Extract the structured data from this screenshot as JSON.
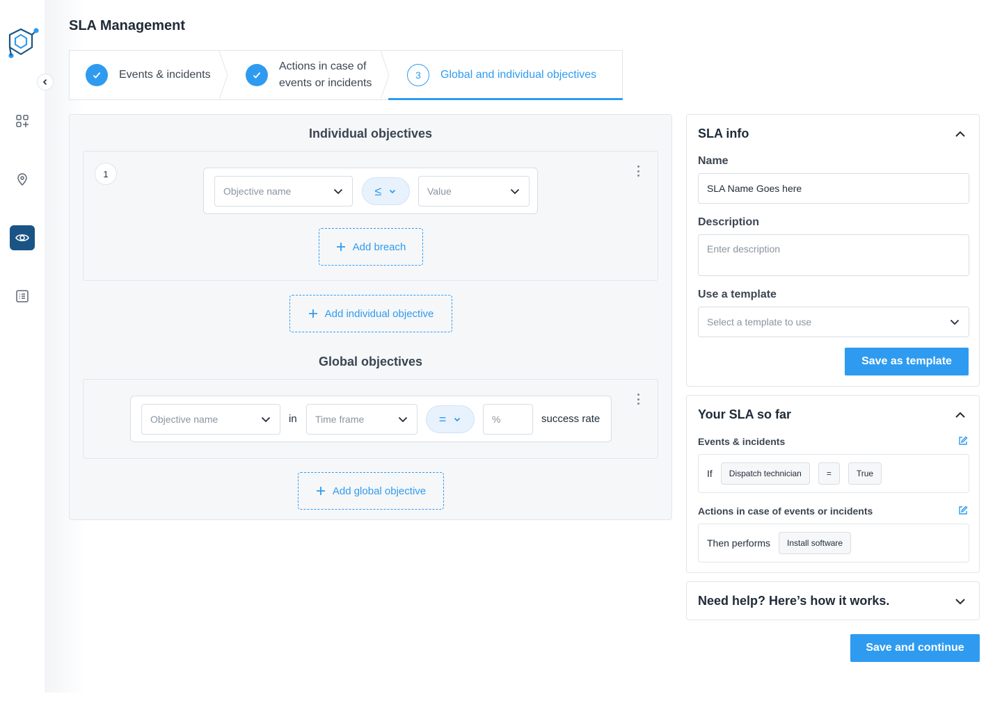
{
  "app": {
    "title": "SLA Management"
  },
  "nav": {
    "items": [
      {
        "name": "dashboard-icon",
        "active": false
      },
      {
        "name": "location-icon",
        "active": false
      },
      {
        "name": "eye-icon",
        "active": true
      },
      {
        "name": "list-icon",
        "active": false
      }
    ]
  },
  "stepper": {
    "steps": [
      {
        "label": "Events & incidents",
        "status": "completed"
      },
      {
        "label": "Actions in case of events or incidents",
        "status": "completed"
      },
      {
        "number": "3",
        "label": "Global and individual objectives",
        "status": "current"
      }
    ]
  },
  "individual": {
    "title": "Individual objectives",
    "objectives": [
      {
        "number": "1",
        "name_placeholder": "Objective name",
        "operator": "≤",
        "value_placeholder": "Value"
      }
    ],
    "add_breach_label": "Add breach",
    "add_objective_label": "Add individual objective"
  },
  "global": {
    "title": "Global objectives",
    "objective": {
      "name_placeholder": "Objective name",
      "in_label": "in",
      "timeframe_placeholder": "Time frame",
      "operator": "=",
      "percent_placeholder": "%",
      "suffix": "success rate"
    },
    "add_objective_label": "Add global objective"
  },
  "sla_info": {
    "title": "SLA info",
    "name_label": "Name",
    "name_value": "SLA Name Goes here",
    "description_label": "Description",
    "description_placeholder": "Enter description",
    "template_label": "Use a template",
    "template_placeholder": "Select a template to use",
    "save_template_label": "Save as template"
  },
  "summary": {
    "title": "Your SLA so far",
    "events_label": "Events & incidents",
    "events_if": "If",
    "events_chips": [
      "Dispatch technician",
      "=",
      "True"
    ],
    "actions_label": "Actions in case of events or incidents",
    "actions_prefix": "Then performs",
    "actions_chips": [
      "Install software"
    ]
  },
  "help": {
    "title": "Need help? Here’s how it works."
  },
  "footer": {
    "save_continue_label": "Save and continue"
  },
  "colors": {
    "accent": "#2e9bf0",
    "nav_active": "#1a5485"
  }
}
